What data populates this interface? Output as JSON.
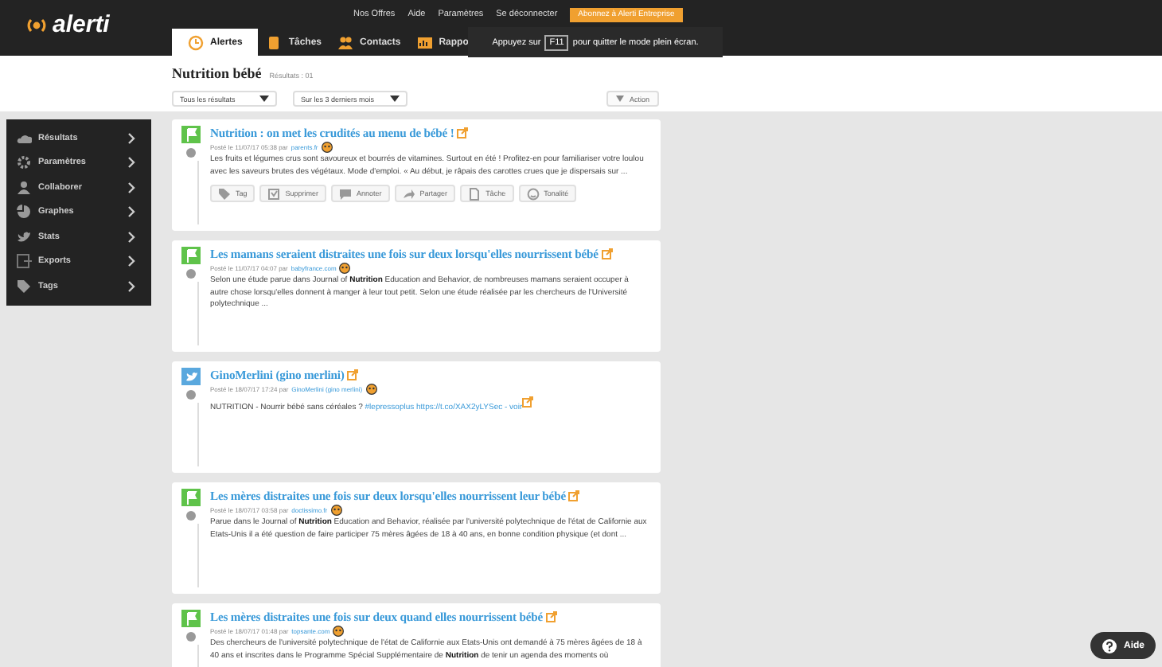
{
  "header": {
    "logo": "alerti",
    "top_links": [
      "Nos Offres",
      "Aide",
      "Paramètres",
      "Se déconnecter"
    ],
    "upgrade_button": "Abonnez à Alerti Entreprise",
    "tabs": [
      {
        "label": "Alertes",
        "selected": true
      },
      {
        "label": "Tâches",
        "selected": false
      },
      {
        "label": "Contacts",
        "selected": false
      },
      {
        "label": "Rappo",
        "selected": false
      }
    ]
  },
  "fullscreen_notice": {
    "before": "Appuyez sur",
    "key": "F11",
    "after": "pour quitter le mode plein écran."
  },
  "toolbar": {
    "title": "Nutrition bébé",
    "results": "Résultats : 01",
    "filters": [
      "Tous les résultats",
      "Sur les 3 derniers mois"
    ],
    "action": "Action"
  },
  "sidebar": {
    "items": [
      {
        "label": "Résultats"
      },
      {
        "label": "Paramètres"
      },
      {
        "label": "Collaborer"
      },
      {
        "label": "Graphes"
      },
      {
        "label": "Stats"
      },
      {
        "label": "Exports"
      },
      {
        "label": "Tags"
      }
    ]
  },
  "results": [
    {
      "kind": "web",
      "title": "Nutrition : on met les crudités au menu de bébé !",
      "posted": "Posté le 11/07/17 05:38 par",
      "source": "parents.fr",
      "text": "Les fruits et légumes crus sont savoureux et bourrés de vitamines. Surtout en été ! Profitez-en pour familiariser votre loulou avec les saveurs brutes des végétaux. Mode d'emploi. « Au début, je râpais des carottes crues que je dispersais sur ...",
      "actions": [
        "Tag",
        "Supprimer",
        "Annoter",
        "Partager",
        "Tâche",
        "Tonalité"
      ]
    },
    {
      "kind": "web",
      "title": "Les mamans seraient distraites une fois sur deux lorsqu'elles nourrissent bébé",
      "posted": "Posté le 11/07/17 04:07 par",
      "source": "babyfrance.com",
      "text": "Selon une étude parue dans Journal of **Nutrition** Education and Behavior, de nombreuses mamans seraient occuper à autre chose lorsqu'elles donnent à manger à leur tout petit. Selon une étude réalisée par les chercheurs de l'Université polytechnique ..."
    },
    {
      "kind": "twitter",
      "title": "GinoMerlini (gino merlini)",
      "posted": "Posté le 18/07/17 17:24 par",
      "source": "GinoMerlini (gino merlini)",
      "text": "NUTRITION - Nourrir bébé sans céréales ?",
      "link": "#lepressoplus https://t.co/XAX2yLYSec - voir"
    },
    {
      "kind": "web",
      "title": "Les mères distraites une fois sur deux lorsqu'elles nourrissent leur bébé",
      "posted": "Posté le 18/07/17 03:58 par",
      "source": "doctissimo.fr",
      "text": "Parue dans le Journal of **Nutrition** Education and Behavior, réalisée par l'université polytechnique de l'état de Californie aux Etats-Unis il a été question de faire participer 75 mères âgées de 18 à 40 ans, en bonne condition physique (et dont ..."
    },
    {
      "kind": "web",
      "title": "Les mères distraites une fois sur deux quand elles nourrissent bébé",
      "posted": "Posté le 18/07/17 01:48 par",
      "source": "topsante.com",
      "text": "Des chercheurs de l'université polytechnique de l'état de Californie aux Etats-Unis ont demandé à 75 mères âgées de 18 à 40 ans et inscrites dans le Programme Spécial Supplémentaire de **Nutrition** de tenir un agenda des moments où"
    }
  ],
  "help_button": "Aide"
}
